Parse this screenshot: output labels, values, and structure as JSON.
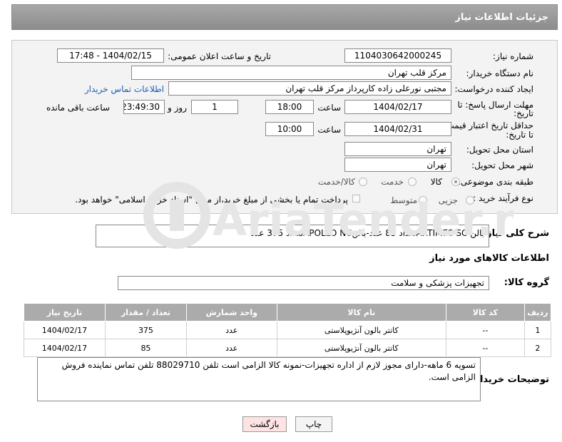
{
  "header": {
    "title": "جزئیات اطلاعات نیاز"
  },
  "form": {
    "need_number_label": "شماره نیاز:",
    "need_number": "1104030642000245",
    "announce_label": "تاریخ و ساعت اعلان عمومی:",
    "announce_value": "1404/02/15 - 17:48",
    "buyer_org_label": "نام دستگاه خریدار:",
    "buyer_org": "مرکز قلب تهران",
    "creator_label": "ایجاد کننده درخواست:",
    "creator": "مجتبی نورعلی زاده کارپرداز مرکز قلب تهران",
    "contact_link": "اطلاعات تماس خریدار",
    "deadline_label_1": "مهلت ارسال پاسخ: تا",
    "deadline_label_2": "تاریخ:",
    "deadline_date": "1404/02/17",
    "time_label": "ساعت",
    "deadline_time": "18:00",
    "days_value": "1",
    "days_label": "روز و",
    "remaining_time": "23:49:30",
    "remaining_label": "ساعت باقی مانده",
    "price_valid_label_1": "حداقل تاریخ اعتبار قیمت:",
    "price_valid_label_2": "تا تاریخ:",
    "price_valid_date": "1404/02/31",
    "price_valid_time": "10:00",
    "province_label": "استان محل تحویل:",
    "province": "تهران",
    "city_label": "شهر محل تحویل:",
    "city": "تهران",
    "category_label": "طبقه بندی موضوعی:",
    "category_options": [
      "کالا",
      "خدمت",
      "کالا/خدمت"
    ],
    "process_label": "نوع فرآیند خرید :",
    "process_options": [
      "جزیی",
      "متوسط"
    ],
    "payment_note": "پرداخت تمام یا بخشی از مبلغ خرید،از محل \"اسناد خزانه اسلامی\" خواهد بود."
  },
  "description": {
    "label": "شرح کلی نیاز:",
    "text": "بالن ARTIMES SCتعداد 85 عدد-بالنAPOLLO NCتعداد 375 عدد"
  },
  "goods": {
    "section_title": "اطلاعات کالاهای مورد نیاز",
    "group_label": "گروه کالا:",
    "group_value": "تجهیزات پزشکی و سلامت",
    "columns": [
      "ردیف",
      "کد کالا",
      "نام کالا",
      "واحد شمارش",
      "تعداد / مقدار",
      "تاریخ نیاز"
    ],
    "rows": [
      {
        "row": "1",
        "code": "--",
        "name": "کاتتر بالون آنژیوپلاستی",
        "unit": "عدد",
        "qty": "375",
        "date": "1404/02/17"
      },
      {
        "row": "2",
        "code": "--",
        "name": "کاتتر بالون آنژیوپلاستی",
        "unit": "عدد",
        "qty": "85",
        "date": "1404/02/17"
      }
    ]
  },
  "notes": {
    "label": "توضیحات خریدار:",
    "text": "تسویه 6 ماهه-دارای مجوز لازم از اداره تجهیزات-نمونه کالا الزامی است تلفن 88029710 تلفن تماس نماینده فروش الزامی است."
  },
  "buttons": {
    "print": "چاپ",
    "back": "بازگشت"
  },
  "watermark": {
    "text": "AriaTender.net"
  }
}
